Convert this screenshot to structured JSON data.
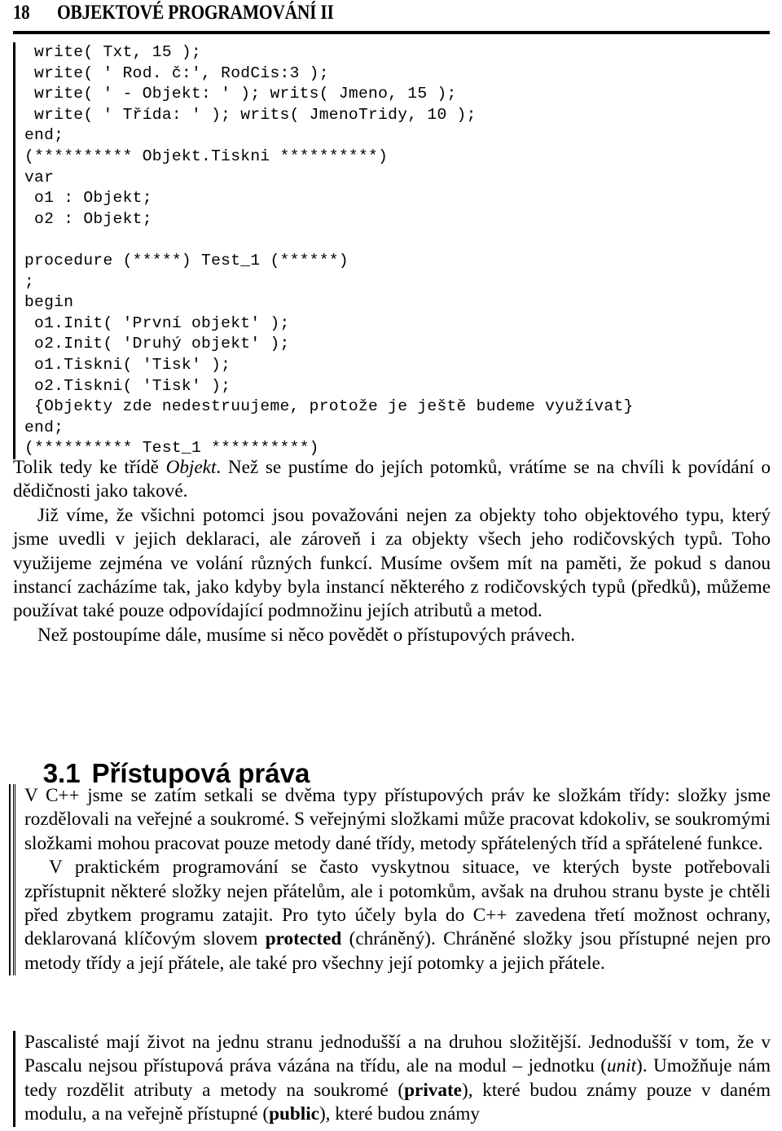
{
  "header": {
    "folio": "18",
    "title": "OBJEKTOVÉ PROGRAMOVÁNÍ II"
  },
  "code_block": {
    "language": "pascal",
    "lines": [
      " write( Txt, 15 );",
      " write( ' Rod. č:', RodCis:3 );",
      " write( ' - Objekt: ' ); writs( Jmeno, 15 );",
      " write( ' Třída: ' ); writs( JmenoTridy, 10 );",
      "end;",
      "(********** Objekt.Tiskni **********)",
      "var",
      " o1 : Objekt;",
      " o2 : Objekt;",
      "",
      "procedure (*****) Test_1 (******)",
      ";",
      "begin",
      " o1.Init( 'První objekt' );",
      " o2.Init( 'Druhý objekt' );",
      " o1.Tiskni( 'Tisk' );",
      " o2.Tiskni( 'Tisk' );",
      " {Objekty zde nedestruujeme, protože je ještě budeme využívat}",
      "end;",
      "(********** Test_1 **********)"
    ]
  },
  "paragraphs_before_heading": {
    "p1_part1": "Tolik tedy ke třídě ",
    "p1_italic": "Objekt",
    "p1_part2": ". Než se pustíme do jejích potomků, vrátíme se na chvíli k povídání o dědičnosti jako takové.",
    "p2": "Již víme, že všichni potomci jsou považováni nejen za objekty toho objektového typu, který jsme uvedli v jejich deklaraci, ale zároveň i za objekty všech jeho rodičovských typů. Toho využijeme zejména ve volání různých funkcí. Musíme ovšem mít na paměti, že pokud s danou instancí zacházíme tak, jako kdyby byla instancí některého z rodičovských typů (předků), můžeme používat také pouze odpovídající podmnožinu jejích atributů a metod.",
    "p3": "Než postoupíme dále, musíme si něco povědět o přístupových právech."
  },
  "section_heading": {
    "number": "3.1",
    "title": "Přístupová práva"
  },
  "bordered_section": {
    "p1": "V C++ jsme se zatím setkali se dvěma typy přístupových práv ke složkám třídy: složky jsme rozdělovali na veřejné a soukromé. S veřejnými složkami může pracovat kdokoliv, se soukromými složkami mohou pracovat pouze metody dané třídy, metody spřátelených tříd a spřátelené funkce.",
    "p2_part1": "V praktickém programování se často vyskytnou situace, ve kterých byste potřebovali zpřístupnit některé složky nejen přátelům, ale i potomkům, avšak na druhou stranu byste je chtěli před zbytkem programu zatajit. Pro tyto účely byla do C++ zavedena třetí možnost ochrany, deklarovaná klíčovým slovem ",
    "p2_bold": "protected",
    "p2_part2": " (chráněný). Chráněné složky jsou přístupné nejen pro metody třídy a její přátele, ale také pro všechny její potomky a jejich přátele."
  },
  "final_section": {
    "p_part1": "Pascalisté mají život na jednu stranu jednodušší a na druhou složitější. Jednodušší v tom, že v Pascalu nejsou přístupová práva vázána na třídu, ale na modul – jednotku (",
    "p_italic": "unit",
    "p_part2": "). Umožňuje nám tedy rozdělit atributy a metody na soukromé (",
    "p_bold1": "private",
    "p_part3": "), které budou známy pouze v daném modulu, a na veřejně přístupné (",
    "p_bold2": "public",
    "p_part4": "), které budou známy"
  },
  "colors": {
    "text": "#000000",
    "background": "#ffffff",
    "rule": "#000000"
  }
}
